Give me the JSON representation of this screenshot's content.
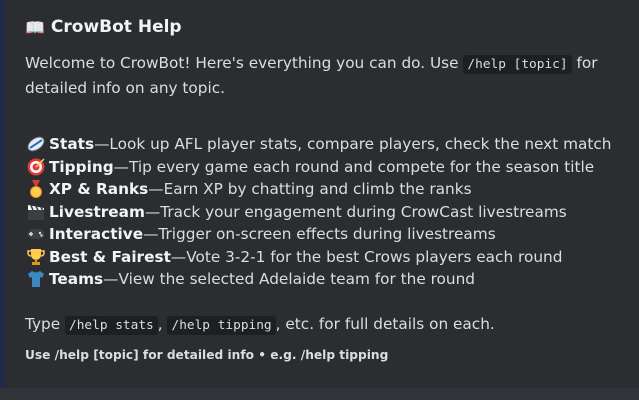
{
  "embed": {
    "title_icon": "open-book-icon",
    "title": "CrowBot Help",
    "intro_text": "Welcome to CrowBot! Here's everything you can do. Use ",
    "intro_code": "/help [topic]",
    "intro_text_2": " for detailed info on any topic.",
    "features": [
      {
        "icon": "rugby-ball-icon",
        "name": "Stats",
        "sep": " — ",
        "desc": "Look up AFL player stats, compare players, check the next match"
      },
      {
        "icon": "target-icon",
        "name": "Tipping",
        "sep": " — ",
        "desc": "Tip every game each round and compete for the season title"
      },
      {
        "icon": "medal-icon",
        "name": "XP & Ranks",
        "sep": " — ",
        "desc": "Earn XP by chatting and climb the ranks"
      },
      {
        "icon": "clapper-board-icon",
        "name": "Livestream",
        "sep": " — ",
        "desc": "Track your engagement during CrowCast livestreams"
      },
      {
        "icon": "game-controller-icon",
        "name": "Interactive",
        "sep": " — ",
        "desc": "Trigger on-screen effects during livestreams"
      },
      {
        "icon": "trophy-icon",
        "name": "Best & Fairest",
        "sep": " — ",
        "desc": "Vote 3-2-1 for the best Crows players each round"
      },
      {
        "icon": "shirt-icon",
        "name": "Teams",
        "sep": " — ",
        "desc": "View the selected Adelaide team for the round"
      }
    ],
    "outro_prefix": "Type ",
    "outro_code_1": "/help stats",
    "outro_comma": ", ",
    "outro_code_2": "/help tipping",
    "outro_suffix": ", etc. for full details on each.",
    "footer": "Use /help [topic] for detailed info • e.g. /help tipping"
  },
  "colors": {
    "embed_bg": "#2b2d31",
    "accent_bar": "#1f2a4d",
    "page_bg": "#323339",
    "text": "#dbdee1"
  }
}
